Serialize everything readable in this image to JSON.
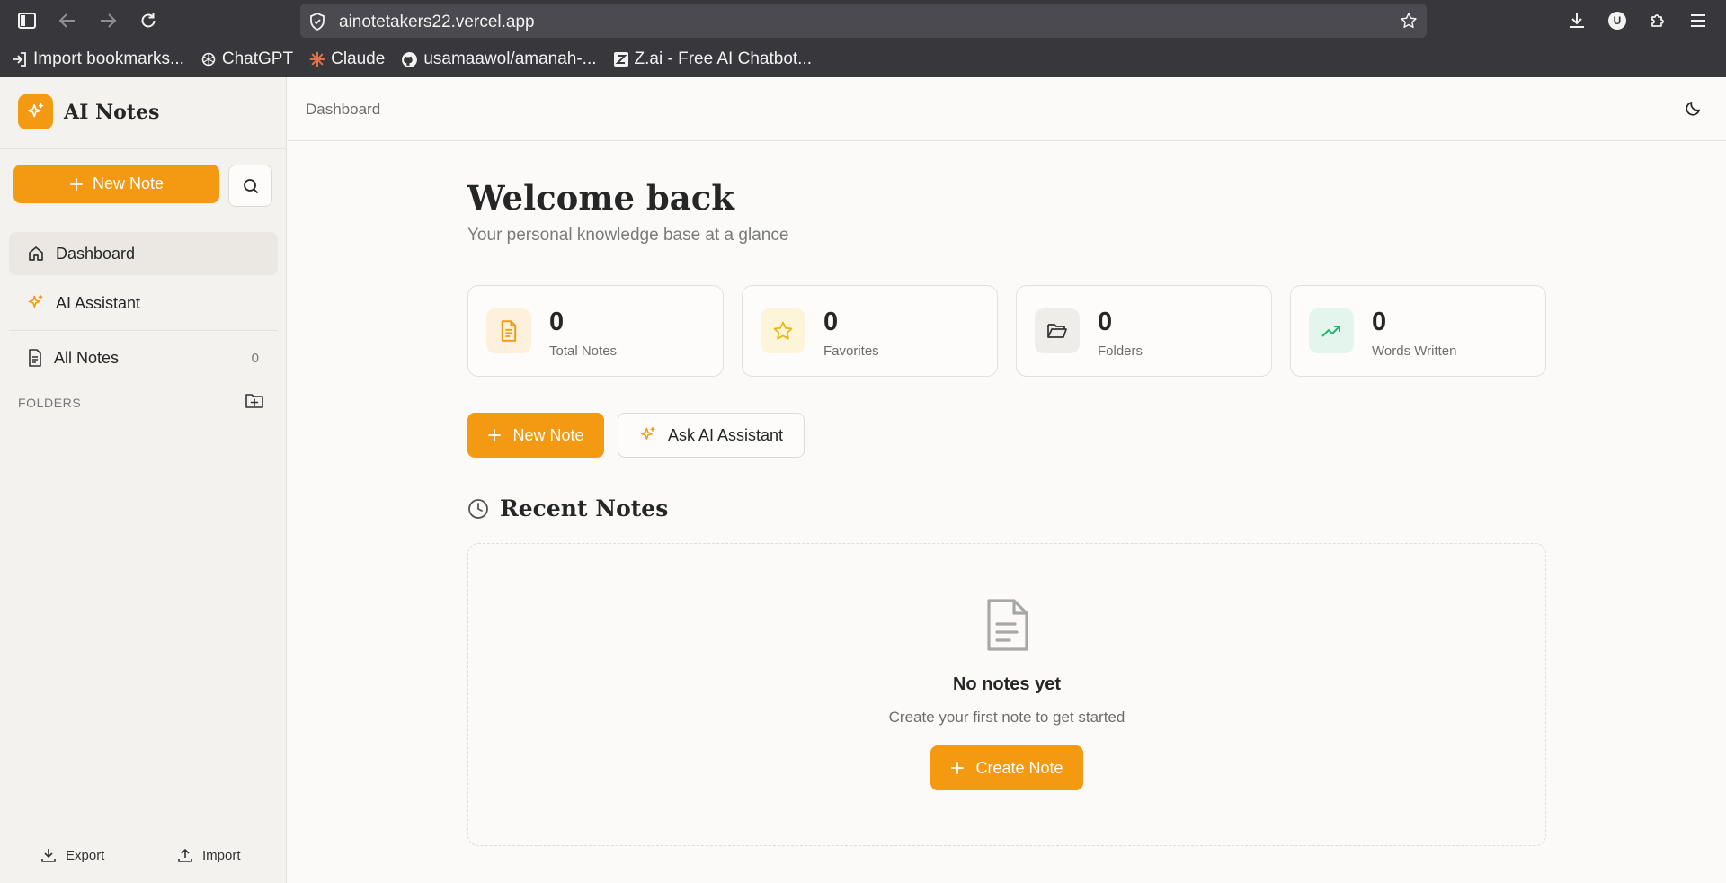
{
  "browser": {
    "url": "ainotetakers22.vercel.app",
    "profile_initial": "U",
    "bookmarks": [
      {
        "label": "Import bookmarks...",
        "icon": "import-icon"
      },
      {
        "label": "ChatGPT",
        "icon": "chatgpt-icon"
      },
      {
        "label": "Claude",
        "icon": "claude-icon"
      },
      {
        "label": "usamaawol/amanah-...",
        "icon": "github-icon"
      },
      {
        "label": "Z.ai - Free AI Chatbot...",
        "icon": "zai-icon"
      }
    ]
  },
  "sidebar": {
    "brand": "AI Notes",
    "new_note_label": "New Note",
    "nav": [
      {
        "label": "Dashboard",
        "icon": "home-icon",
        "active": true
      },
      {
        "label": "AI Assistant",
        "icon": "sparkles-icon",
        "active": false
      },
      {
        "label": "All Notes",
        "icon": "file-icon",
        "count": "0"
      }
    ],
    "folders_label": "FOLDERS",
    "export_label": "Export",
    "import_label": "Import"
  },
  "header": {
    "breadcrumb": "Dashboard"
  },
  "main": {
    "title": "Welcome back",
    "subtitle": "Your personal knowledge base at a glance",
    "stats": [
      {
        "value": "0",
        "label": "Total Notes",
        "icon": "file-text-icon",
        "color": "#f39a12",
        "bg": "#fdf0dc"
      },
      {
        "value": "0",
        "label": "Favorites",
        "icon": "star-icon",
        "color": "#e9b90f",
        "bg": "#fcf5da"
      },
      {
        "value": "0",
        "label": "Folders",
        "icon": "folder-open-icon",
        "color": "#333333",
        "bg": "#efedea"
      },
      {
        "value": "0",
        "label": "Words Written",
        "icon": "trending-up-icon",
        "color": "#22b573",
        "bg": "#e3f5ec"
      }
    ],
    "new_note_label": "New Note",
    "ask_ai_label": "Ask AI Assistant",
    "recent_title": "Recent Notes",
    "empty_title": "No notes yet",
    "empty_subtitle": "Create your first note to get started",
    "create_label": "Create Note"
  },
  "colors": {
    "accent": "#f39a12",
    "chrome": "#38373b"
  }
}
